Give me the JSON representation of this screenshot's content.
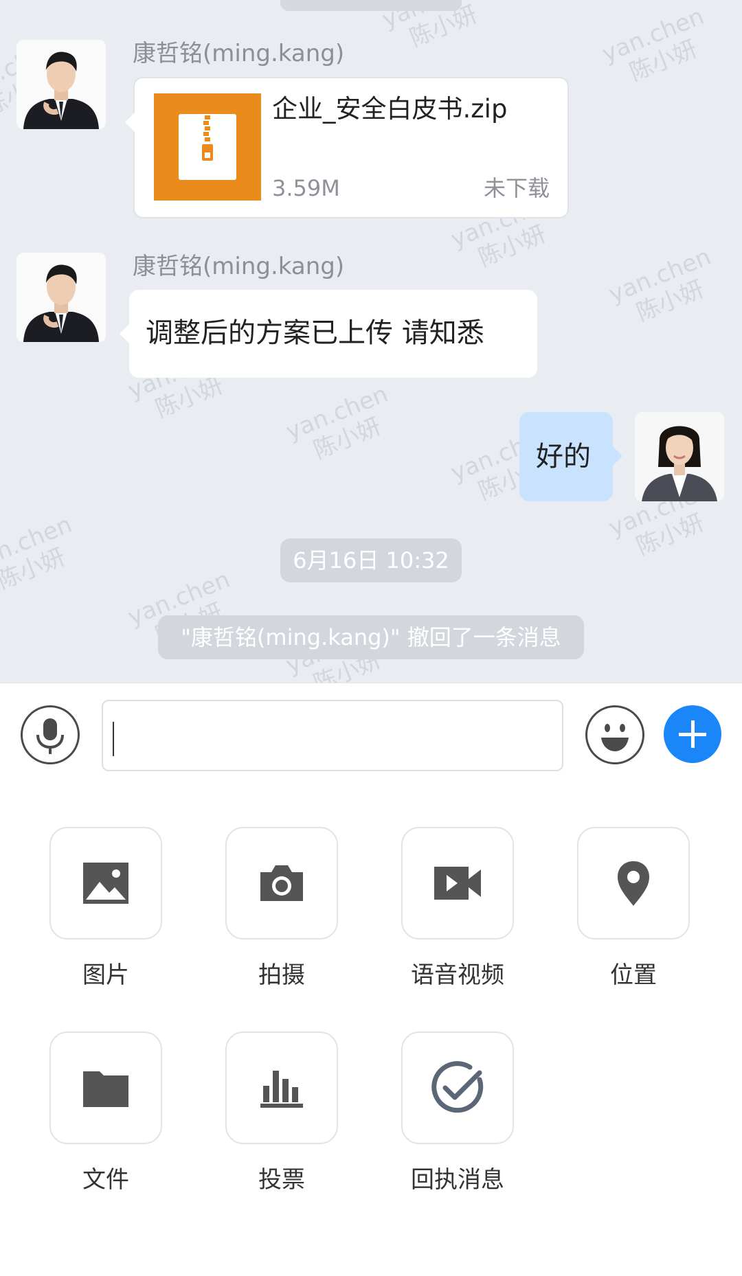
{
  "chat": {
    "messages": [
      {
        "type": "file",
        "sender": "康哲铭(ming.kang)",
        "file_name": "企业_安全白皮书.zip",
        "file_size": "3.59M",
        "status": "未下载",
        "file_icon": "zip-file-icon",
        "file_icon_color": "#e98c1b"
      },
      {
        "type": "text",
        "sender": "康哲铭(ming.kang)",
        "text": "调整后的方案已上传 请知悉"
      },
      {
        "type": "text",
        "direction": "outgoing",
        "text": "好的",
        "bubble_color": "#c9e3ff"
      }
    ],
    "timestamp": "6月16日 10:32",
    "recall_notice": "\"康哲铭(ming.kang)\" 撤回了一条消息",
    "watermark": {
      "line1": "yan.chen",
      "line2": "陈小妍"
    }
  },
  "input_bar": {
    "voice_icon": "microphone-icon",
    "input_value": "",
    "emoji_icon": "smiley-icon",
    "plus_icon": "plus-icon",
    "accent_color": "#1a86f7"
  },
  "tools": [
    {
      "label": "图片",
      "icon": "image-icon"
    },
    {
      "label": "拍摄",
      "icon": "camera-icon"
    },
    {
      "label": "语音视频",
      "icon": "video-call-icon"
    },
    {
      "label": "位置",
      "icon": "location-pin-icon"
    },
    {
      "label": "文件",
      "icon": "folder-icon"
    },
    {
      "label": "投票",
      "icon": "poll-icon"
    },
    {
      "label": "回执消息",
      "icon": "receipt-check-icon"
    }
  ]
}
